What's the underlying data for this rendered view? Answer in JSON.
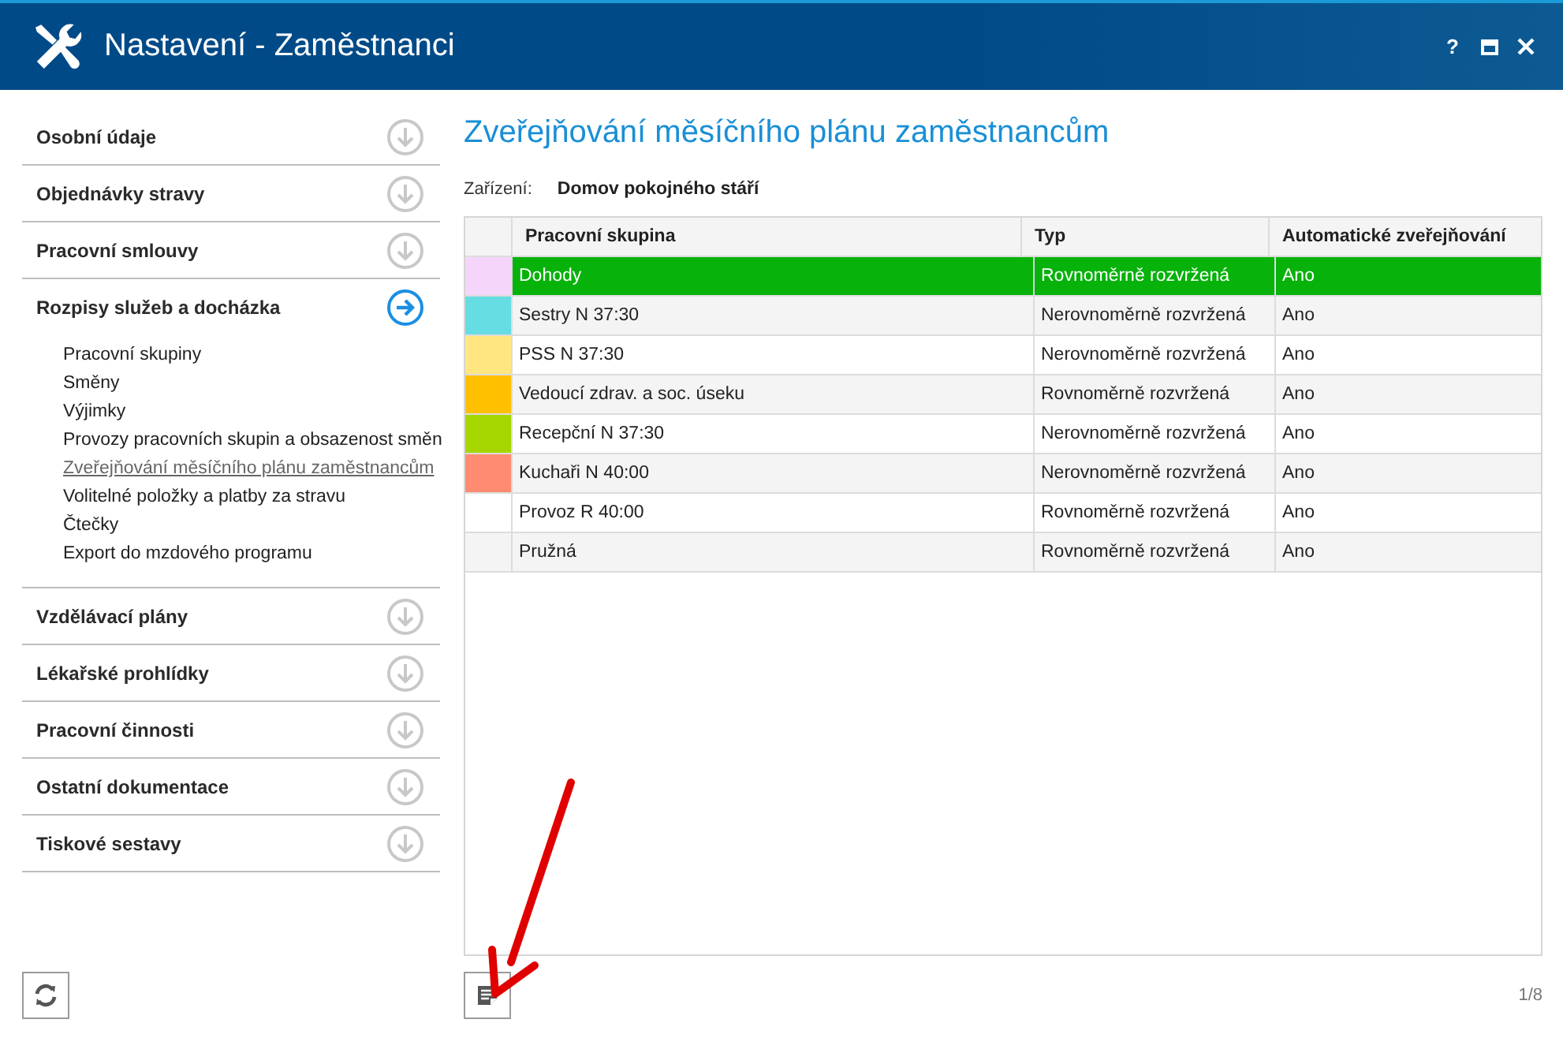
{
  "window": {
    "title": "Nastavení - Zaměstnanci",
    "controls": [
      "?"
    ]
  },
  "sidebar": {
    "sections": [
      {
        "label": "Osobní údaje",
        "expanded": false
      },
      {
        "label": "Objednávky stravy",
        "expanded": false
      },
      {
        "label": "Pracovní smlouvy",
        "expanded": false
      },
      {
        "label": "Rozpisy služeb a docházka",
        "expanded": true,
        "children": [
          {
            "label": "Pracovní skupiny",
            "selected": false
          },
          {
            "label": "Směny",
            "selected": false
          },
          {
            "label": "Výjimky",
            "selected": false
          },
          {
            "label": "Provozy pracovních skupin a obsazenost směn",
            "selected": false
          },
          {
            "label": "Zveřejňování měsíčního plánu zaměstnancům",
            "selected": true
          },
          {
            "label": "Volitelné položky a platby za stravu",
            "selected": false
          },
          {
            "label": "Čtečky",
            "selected": false
          },
          {
            "label": "Export do mzdového programu",
            "selected": false
          }
        ]
      },
      {
        "label": "Vzdělávací plány",
        "expanded": false
      },
      {
        "label": "Lékařské prohlídky",
        "expanded": false
      },
      {
        "label": "Pracovní činnosti",
        "expanded": false
      },
      {
        "label": "Ostatní dokumentace",
        "expanded": false
      },
      {
        "label": "Tiskové sestavy",
        "expanded": false
      }
    ]
  },
  "main": {
    "heading": "Zveřejňování měsíčního plánu zaměstnancům",
    "facility_label": "Zařízení:",
    "facility_value": "Domov pokojného stáří"
  },
  "table": {
    "columns": [
      "Pracovní skupina",
      "Typ",
      "Automatické zveřejňování"
    ],
    "rows": [
      {
        "color": "#f5d5fa",
        "cells": [
          "Dohody",
          "Rovnoměrně rozvržená",
          "Ano"
        ],
        "selected": true
      },
      {
        "color": "#66dde3",
        "cells": [
          "Sestry N 37:30",
          "Nerovnoměrně rozvržená",
          "Ano"
        ],
        "selected": false
      },
      {
        "color": "#ffe680",
        "cells": [
          "PSS N 37:30",
          "Nerovnoměrně rozvržená",
          "Ano"
        ],
        "selected": false
      },
      {
        "color": "#ffc000",
        "cells": [
          "Vedoucí zdrav. a soc. úseku",
          "Rovnoměrně rozvržená",
          "Ano"
        ],
        "selected": false
      },
      {
        "color": "#a6d600",
        "cells": [
          "Recepční N 37:30",
          "Nerovnoměrně rozvržená",
          "Ano"
        ],
        "selected": false
      },
      {
        "color": "#ff8c70",
        "cells": [
          "Kuchaři N 40:00",
          "Nerovnoměrně rozvržená",
          "Ano"
        ],
        "selected": false
      },
      {
        "cells": [
          "Provoz R 40:00",
          "Rovnoměrně rozvržená",
          "Ano"
        ],
        "selected": false
      },
      {
        "cells": [
          "Pružná",
          "Rovnoměrně rozvržená",
          "Ano"
        ],
        "selected": false
      }
    ]
  },
  "pager": "1/8"
}
